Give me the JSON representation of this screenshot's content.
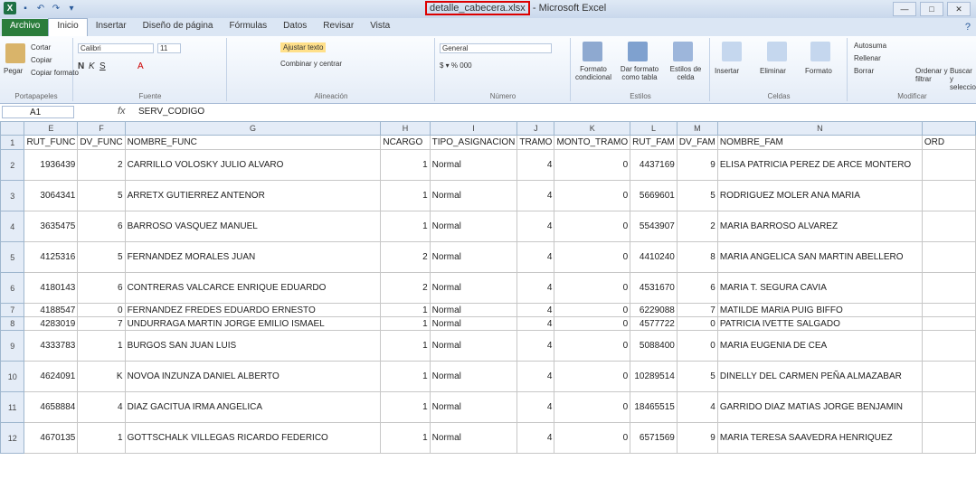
{
  "window": {
    "file_name": "detalle_cabecera.xlsx",
    "title_rest": " - Microsoft Excel",
    "controls": [
      "—",
      "□",
      "✕"
    ]
  },
  "tabs": [
    "Archivo",
    "Inicio",
    "Insertar",
    "Diseño de página",
    "Fórmulas",
    "Datos",
    "Revisar",
    "Vista"
  ],
  "ribbon": {
    "clipboard": {
      "paste": "Pegar",
      "cut": "Cortar",
      "copy": "Copiar",
      "format_painter": "Copiar formato",
      "label": "Portapapeles"
    },
    "font": {
      "name": "Calibri",
      "size": "11",
      "label": "Fuente"
    },
    "alignment": {
      "wrap": "Ajustar texto",
      "merge": "Combinar y centrar",
      "label": "Alineación"
    },
    "number": {
      "format": "General",
      "label": "Número"
    },
    "styles": {
      "cond": "Formato condicional",
      "table": "Dar formato como tabla",
      "cell": "Estilos de celda",
      "label": "Estilos"
    },
    "cells": {
      "insert": "Insertar",
      "delete": "Eliminar",
      "format": "Formato",
      "label": "Celdas"
    },
    "editing": {
      "autosum": "Autosuma",
      "fill": "Rellenar",
      "clear": "Borrar",
      "sort": "Ordenar y filtrar",
      "find": "Buscar y seleccionar",
      "label": "Modificar"
    }
  },
  "formula_bar": {
    "cell": "A1",
    "fx": "fx",
    "content": "SERV_CODIGO"
  },
  "columns": [
    "E",
    "F",
    "G",
    "H",
    "I",
    "J",
    "K",
    "L",
    "M",
    "N"
  ],
  "header_row": [
    "RUT_FUNC",
    "DV_FUNC",
    "NOMBRE_FUNC",
    "NCARGO",
    "TIPO_ASIGNACION",
    "TRAMO",
    "MONTO_TRAMO",
    "RUT_FAM",
    "DV_FAM",
    "NOMBRE_FAM",
    "ORD"
  ],
  "rows": [
    {
      "n": "2",
      "rut": "1936439",
      "dv": "2",
      "nombre": "CARRILLO VOLOSKY JULIO ALVARO",
      "ncargo": "1",
      "tipo": "Normal",
      "tramo": "4",
      "monto": "0",
      "rut_fam": "4437169",
      "dv_fam": "9",
      "fam": "ELISA PATRICIA PEREZ DE ARCE MONTERO"
    },
    {
      "n": "3",
      "rut": "3064341",
      "dv": "5",
      "nombre": "ARRETX GUTIERREZ ANTENOR",
      "ncargo": "1",
      "tipo": "Normal",
      "tramo": "4",
      "monto": "0",
      "rut_fam": "5669601",
      "dv_fam": "5",
      "fam": "RODRIGUEZ MOLER ANA MARIA"
    },
    {
      "n": "4",
      "rut": "3635475",
      "dv": "6",
      "nombre": "BARROSO VASQUEZ MANUEL",
      "ncargo": "1",
      "tipo": "Normal",
      "tramo": "4",
      "monto": "0",
      "rut_fam": "5543907",
      "dv_fam": "2",
      "fam": "MARIA BARROSO ALVAREZ"
    },
    {
      "n": "5",
      "rut": "4125316",
      "dv": "5",
      "nombre": "FERNANDEZ MORALES JUAN",
      "ncargo": "2",
      "tipo": "Normal",
      "tramo": "4",
      "monto": "0",
      "rut_fam": "4410240",
      "dv_fam": "8",
      "fam": "MARIA ANGELICA SAN MARTIN ABELLERO"
    },
    {
      "n": "6",
      "rut": "4180143",
      "dv": "6",
      "nombre": "CONTRERAS VALCARCE ENRIQUE EDUARDO",
      "ncargo": "2",
      "tipo": "Normal",
      "tramo": "4",
      "monto": "0",
      "rut_fam": "4531670",
      "dv_fam": "6",
      "fam": "MARIA T. SEGURA CAVIA"
    },
    {
      "n": "7",
      "rut": "4188547",
      "dv": "0",
      "nombre": "FERNANDEZ FREDES EDUARDO ERNESTO",
      "ncargo": "1",
      "tipo": "Normal",
      "tramo": "4",
      "monto": "0",
      "rut_fam": "6229088",
      "dv_fam": "7",
      "fam": "MATILDE MARIA PUIG BIFFO"
    },
    {
      "n": "8",
      "rut": "4283019",
      "dv": "7",
      "nombre": "UNDURRAGA MARTIN JORGE EMILIO ISMAEL",
      "ncargo": "1",
      "tipo": "Normal",
      "tramo": "4",
      "monto": "0",
      "rut_fam": "4577722",
      "dv_fam": "0",
      "fam": "PATRICIA IVETTE SALGADO"
    },
    {
      "n": "9",
      "rut": "4333783",
      "dv": "1",
      "nombre": "BURGOS SAN JUAN LUIS",
      "ncargo": "1",
      "tipo": "Normal",
      "tramo": "4",
      "monto": "0",
      "rut_fam": "5088400",
      "dv_fam": "0",
      "fam": "MARIA EUGENIA DE CEA"
    },
    {
      "n": "10",
      "rut": "4624091",
      "dv": "K",
      "nombre": "NOVOA INZUNZA DANIEL ALBERTO",
      "ncargo": "1",
      "tipo": "Normal",
      "tramo": "4",
      "monto": "0",
      "rut_fam": "10289514",
      "dv_fam": "5",
      "fam": "DINELLY DEL CARMEN PEÑA ALMAZABAR"
    },
    {
      "n": "11",
      "rut": "4658884",
      "dv": "4",
      "nombre": "DIAZ GACITUA IRMA ANGELICA",
      "ncargo": "1",
      "tipo": "Normal",
      "tramo": "4",
      "monto": "0",
      "rut_fam": "18465515",
      "dv_fam": "4",
      "fam": "GARRIDO DIAZ MATIAS JORGE BENJAMIN"
    },
    {
      "n": "12",
      "rut": "4670135",
      "dv": "1",
      "nombre": "GOTTSCHALK VILLEGAS RICARDO FEDERICO",
      "ncargo": "1",
      "tipo": "Normal",
      "tramo": "4",
      "monto": "0",
      "rut_fam": "6571569",
      "dv_fam": "9",
      "fam": "MARIA TERESA SAAVEDRA HENRIQUEZ"
    }
  ]
}
